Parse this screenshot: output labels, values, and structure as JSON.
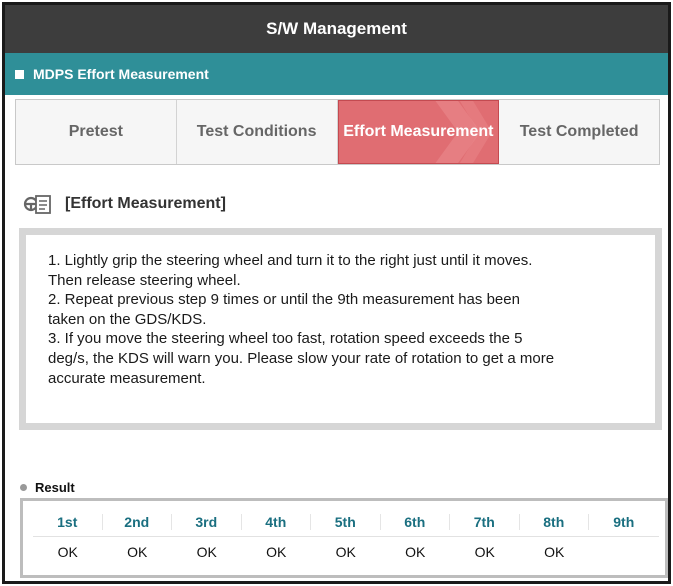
{
  "window": {
    "title": "S/W Management"
  },
  "subheader": {
    "title": "MDPS Effort Measurement"
  },
  "steps": [
    {
      "label": "Pretest",
      "active": false
    },
    {
      "label": "Test Conditions",
      "active": false
    },
    {
      "label": "Effort Measurement",
      "active": true
    },
    {
      "label": "Test Completed",
      "active": false
    }
  ],
  "section": {
    "title": "[Effort Measurement]",
    "icon": "document-steering-icon"
  },
  "instructions": {
    "lines": [
      "1. Lightly grip the steering wheel and turn it to the right just until it moves.",
      "Then release steering wheel.",
      "2. Repeat previous step 9 times or until the 9th measurement has been",
      "taken on the GDS/KDS.",
      "3. If you move the steering wheel too fast, rotation speed exceeds the 5",
      "deg/s, the KDS will warn you. Please slow your rate of rotation to get a more",
      "accurate measurement."
    ]
  },
  "result": {
    "label": "Result",
    "headers": [
      "1st",
      "2nd",
      "3rd",
      "4th",
      "5th",
      "6th",
      "7th",
      "8th",
      "9th"
    ],
    "values": [
      "OK",
      "OK",
      "OK",
      "OK",
      "OK",
      "OK",
      "OK",
      "OK",
      ""
    ]
  },
  "colors": {
    "titlebar": "#3d3d3d",
    "subbar": "#2f8f98",
    "active_step": "#e06d72",
    "result_header_text": "#1a6f80"
  }
}
